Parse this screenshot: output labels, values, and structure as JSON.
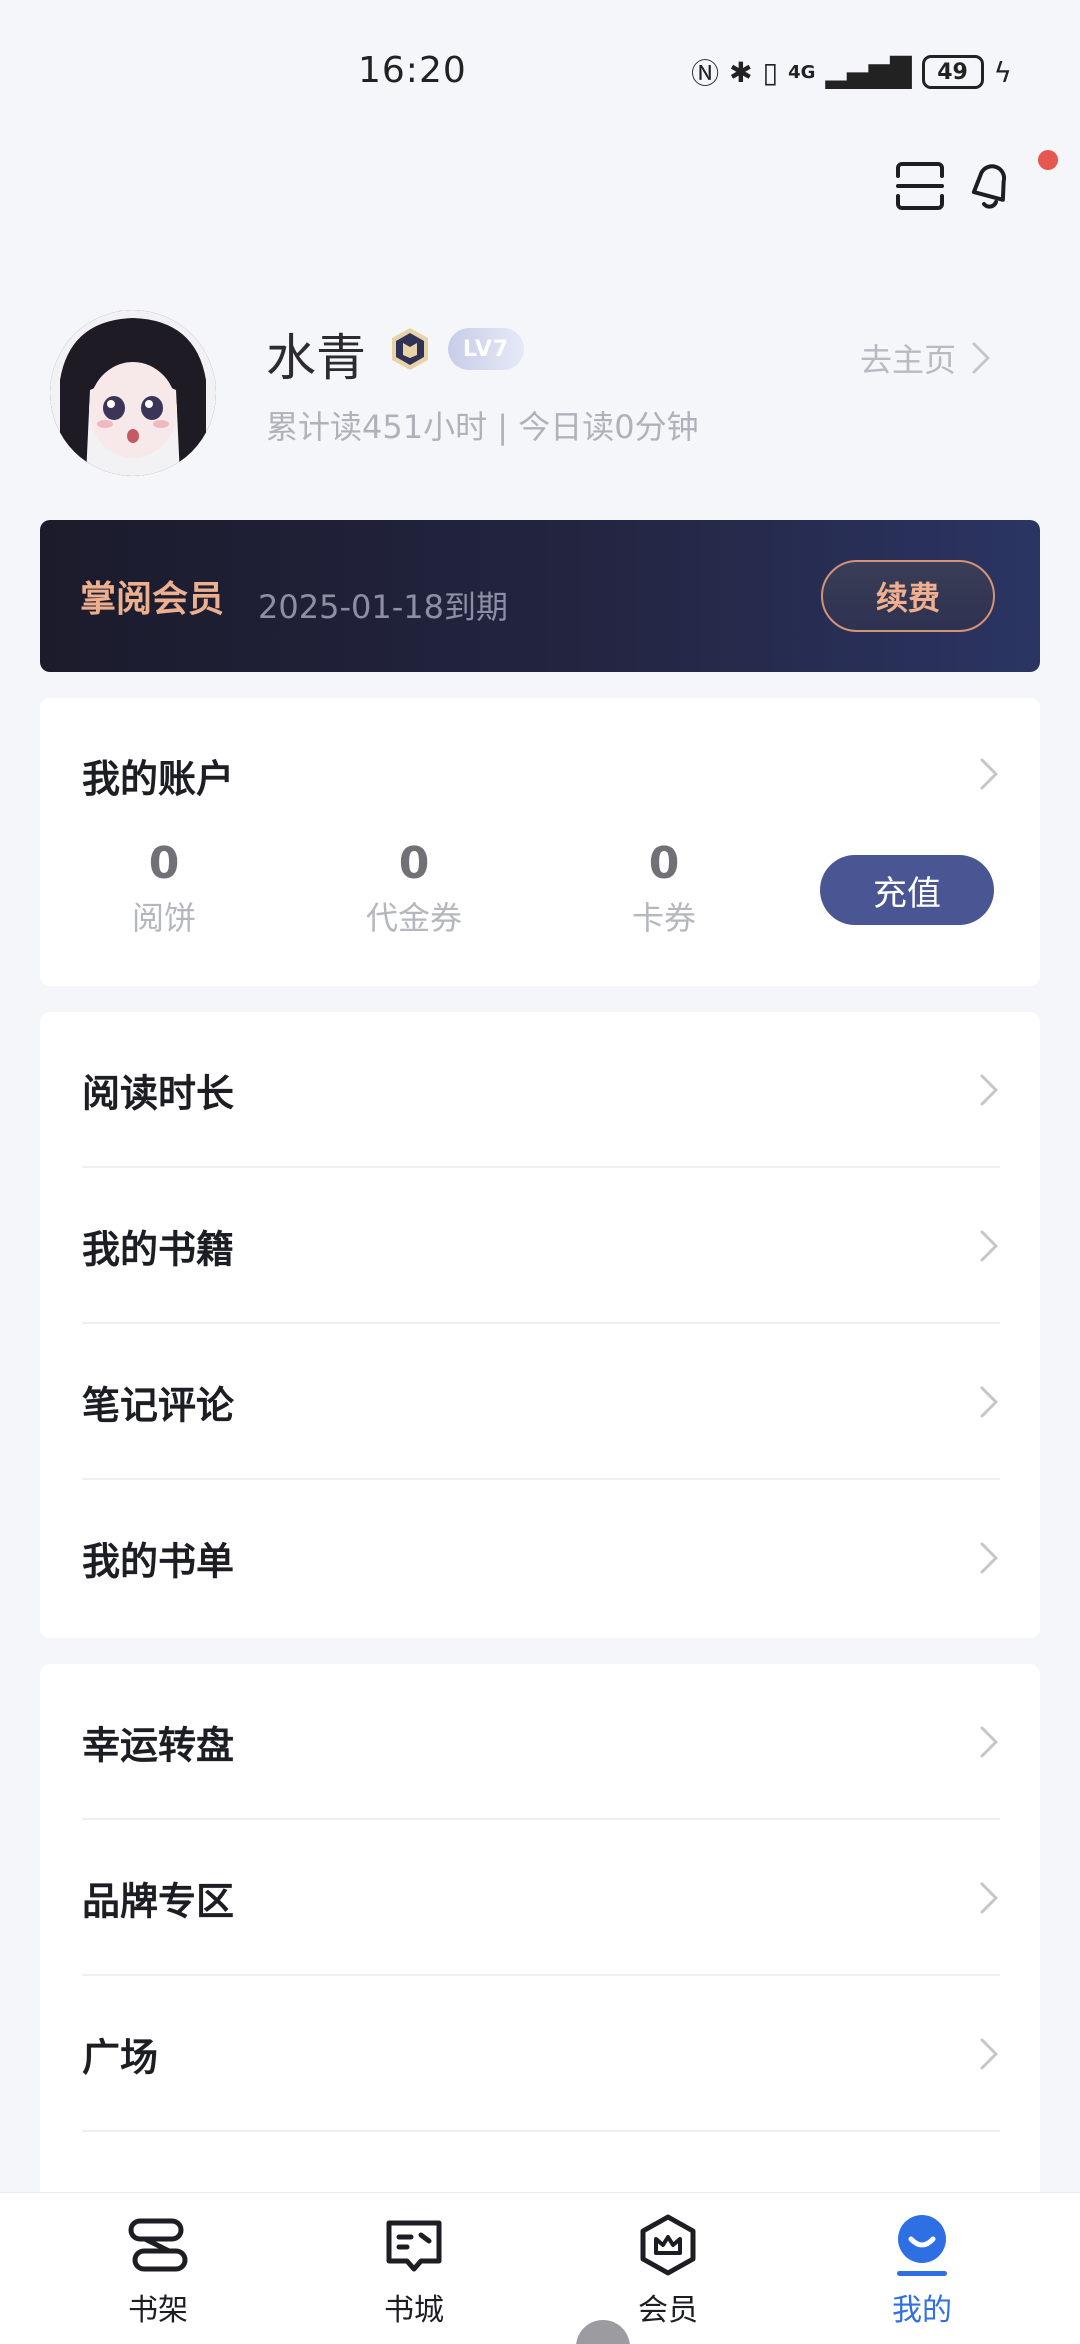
{
  "status_bar": {
    "time": "16:20",
    "battery": "49",
    "network": "4G"
  },
  "profile": {
    "name": "水青",
    "level": "LV7",
    "go_home_label": "去主页",
    "reading_stats": "累计读451小时 | 今日读0分钟"
  },
  "member": {
    "title": "掌阅会员",
    "expiry": "2025-01-18到期",
    "renew_label": "续费"
  },
  "account": {
    "title": "我的账户",
    "stats": [
      {
        "value": "0",
        "label": "阅饼"
      },
      {
        "value": "0",
        "label": "代金券"
      },
      {
        "value": "0",
        "label": "卡券"
      }
    ],
    "recharge_label": "充值"
  },
  "menu_group_1": [
    {
      "label": "阅读时长"
    },
    {
      "label": "我的书籍"
    },
    {
      "label": "笔记评论"
    },
    {
      "label": "我的书单"
    }
  ],
  "menu_group_2": [
    {
      "label": "幸运转盘"
    },
    {
      "label": "品牌专区"
    },
    {
      "label": "广场"
    }
  ],
  "bottom_nav": [
    {
      "label": "书架",
      "icon": "bookshelf-icon"
    },
    {
      "label": "书城",
      "icon": "bookstore-icon"
    },
    {
      "label": "会员",
      "icon": "vip-icon"
    },
    {
      "label": "我的",
      "icon": "profile-icon",
      "active": true
    }
  ],
  "colors": {
    "accent": "#2f6fe4",
    "member_gold": "#ecb08f",
    "recharge": "#4a5693",
    "notification": "#e6574f"
  }
}
